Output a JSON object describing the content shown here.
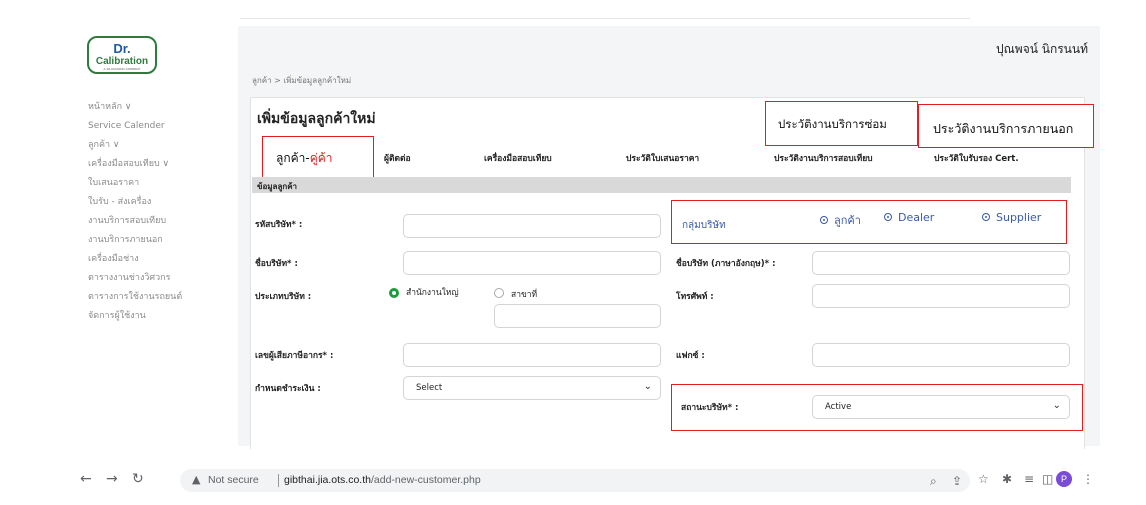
{
  "logo": {
    "main": "Dr.",
    "sub": "Calibration",
    "caption": "A JIA HOLDING COMPANY"
  },
  "user": {
    "name": "ปุณพจน์ นิกรนนท์"
  },
  "breadcrumb": "ลูกค้า > เพิ่มข้อมูลลูกค้าใหม่",
  "sidebar": {
    "items": [
      {
        "label": "หน้าหลัก ∨"
      },
      {
        "label": "Service Calender"
      },
      {
        "label": "ลูกค้า ∨"
      },
      {
        "label": "เครื่องมือสอบเทียบ ∨"
      },
      {
        "label": "ใบเสนอราคา"
      },
      {
        "label": "ใบรับ - ส่งเครื่อง"
      },
      {
        "label": "งานบริการสอบเทียบ"
      },
      {
        "label": "งานบริการภายนอก"
      },
      {
        "label": "เครื่องมือช่าง"
      },
      {
        "label": "ตารางงานช่างวิศวกร"
      },
      {
        "label": "ตารางการใช้งานรถยนต์"
      },
      {
        "label": "จัดการผู้ใช้งาน"
      }
    ]
  },
  "page_title": "เพิ่มข้อมูลลูกค้าใหม่",
  "annotations": {
    "repair_history": "ประวัติงานบริการซ่อม",
    "outside_history": "ประวัติงานบริการภายนอก",
    "customer_tab_prefix": "ลูกค้า-",
    "customer_tab_suffix": "คู่ค้า"
  },
  "tabs": [
    {
      "label": "ผู้ติดต่อ"
    },
    {
      "label": "เครื่องมือสอบเทียบ"
    },
    {
      "label": "ประวัติใบเสนอราคา"
    },
    {
      "label": "ประวัติงานบริการสอบเทียบ"
    },
    {
      "label": "ประวัติใบรับรอง Cert."
    }
  ],
  "section": {
    "title": "ข้อมูลลูกค้า"
  },
  "form": {
    "company_code_label": "รหัสบริษัท* :",
    "company_code_value": "",
    "company_name_label": "ชื่อบริษัท* :",
    "company_name_value": "",
    "company_name_en_label": "ชื่อบริษัท (ภาษาอังกฤษ)* :",
    "company_name_en_value": "",
    "company_type_label": "ประเภทบริษัท :",
    "company_type_options": [
      "สำนักงานใหญ่",
      "สาขาที่"
    ],
    "phone_label": "โทรศัพท์ :",
    "phone_value": "",
    "tax_id_label": "เลขผู้เสียภาษีอากร* :",
    "tax_id_value": "",
    "fax_label": "แฟกซ์ :",
    "fax_value": "",
    "payment_label": "กำหนดชำระเงิน :",
    "payment_value": "Select",
    "status_label": "สถานะบริษัท* :",
    "status_value": "Active",
    "group_label": "กลุ่มบริษัท",
    "group_options": [
      "ลูกค้า",
      "Dealer",
      "Supplier"
    ]
  },
  "browser": {
    "not_secure": "Not secure",
    "url_host": "gibthai.jia.ots.co.th",
    "url_path": "/add-new-customer.php",
    "profile_initial": "P"
  }
}
